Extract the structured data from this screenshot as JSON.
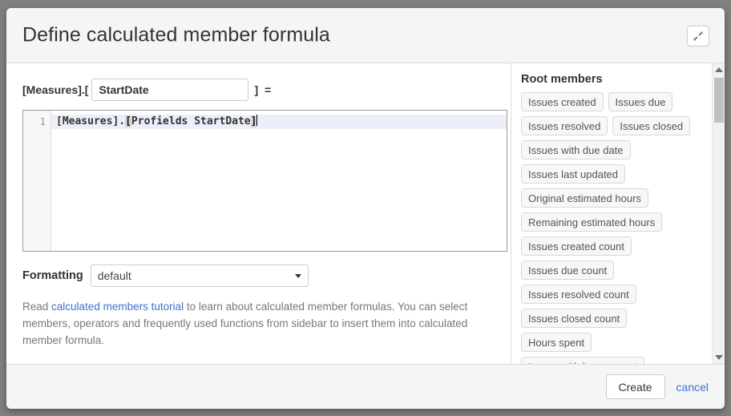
{
  "dialog": {
    "title": "Define calculated member formula",
    "expand_icon": "expand-diagonal-icon"
  },
  "name_row": {
    "prefix": "[Measures].[",
    "member_name": "StartDate",
    "member_name_placeholder": "",
    "suffix": "] ="
  },
  "editor": {
    "line_number": "1",
    "code_segment_1": "[Measures].",
    "code_bracket_open": "[",
    "code_segment_2": "Profields StartDate",
    "code_bracket_close": "]",
    "full_text": "[Measures].[Profields StartDate]"
  },
  "formatting": {
    "label": "Formatting",
    "selected": "default",
    "options": [
      "default"
    ]
  },
  "help": {
    "before_link": "Read ",
    "link_text": "calculated members tutorial",
    "after_link": " to learn about calculated member formulas. You can select members, operators and frequently used functions from sidebar to insert them into calculated member formula."
  },
  "sidebar": {
    "heading": "Root members",
    "members": [
      "Issues created",
      "Issues due",
      "Issues resolved",
      "Issues closed",
      "Issues with due date",
      "Issues last updated",
      "Original estimated hours",
      "Remaining estimated hours",
      "Issues created count",
      "Issues due count",
      "Issues resolved count",
      "Issues closed count",
      "Hours spent",
      "Issues with hours spent"
    ],
    "scrollbar": {
      "up_icon": "chevron-up-icon",
      "down_icon": "chevron-down-icon"
    }
  },
  "footer": {
    "create_label": "Create",
    "cancel_label": "cancel"
  },
  "colors": {
    "link": "#3b73cc",
    "header_bg": "#f5f5f5",
    "active_line": "#eceff9",
    "pill_bg": "#f7f7f7"
  }
}
